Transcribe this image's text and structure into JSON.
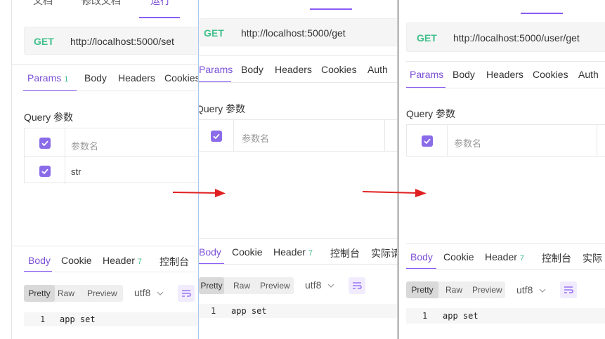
{
  "panels": [
    {
      "top_tabs": [
        "文档",
        "修改文档",
        "运行"
      ],
      "method": "GET",
      "url": "http://localhost:5000/set",
      "request_tabs": [
        {
          "label": "Params",
          "badge": "1"
        },
        {
          "label": "Body"
        },
        {
          "label": "Headers"
        },
        {
          "label": "Cookies"
        }
      ],
      "query_title": "Query 参数",
      "param_header": "参数名",
      "params": [
        {
          "name": "str"
        }
      ],
      "response_tabs": [
        {
          "label": "Body"
        },
        {
          "label": "Cookie"
        },
        {
          "label": "Header",
          "badge": "7"
        },
        {
          "label": "控制台"
        }
      ],
      "view_modes": [
        "Pretty",
        "Raw",
        "Preview"
      ],
      "encoding": "utf8",
      "code_lines": [
        {
          "no": "1",
          "text": "app set"
        }
      ]
    },
    {
      "method": "GET",
      "url": "http://localhost:5000/get",
      "request_tabs": [
        {
          "label": "Params"
        },
        {
          "label": "Body"
        },
        {
          "label": "Headers"
        },
        {
          "label": "Cookies"
        },
        {
          "label": "Auth"
        }
      ],
      "query_title": "Query 参数",
      "param_header": "参数名",
      "response_tabs": [
        {
          "label": "Body"
        },
        {
          "label": "Cookie"
        },
        {
          "label": "Header",
          "badge": "7"
        },
        {
          "label": "控制台"
        },
        {
          "label": "实际请"
        }
      ],
      "view_modes": [
        "Pretty",
        "Raw",
        "Preview"
      ],
      "encoding": "utf8",
      "code_lines": [
        {
          "no": "1",
          "text": "app set"
        }
      ]
    },
    {
      "method": "GET",
      "url": "http://localhost:5000/user/get",
      "request_tabs": [
        {
          "label": "Params"
        },
        {
          "label": "Body"
        },
        {
          "label": "Headers"
        },
        {
          "label": "Cookies"
        },
        {
          "label": "Auth"
        }
      ],
      "query_title": "Query 参数",
      "param_header": "参数名",
      "response_tabs": [
        {
          "label": "Body"
        },
        {
          "label": "Cookie"
        },
        {
          "label": "Header",
          "badge": "7"
        },
        {
          "label": "控制台"
        },
        {
          "label": "实际"
        }
      ],
      "view_modes": [
        "Pretty",
        "Raw",
        "Preview"
      ],
      "encoding": "utf8",
      "code_lines": [
        {
          "no": "1",
          "text": "app set"
        }
      ]
    }
  ],
  "colors": {
    "accent": "#8a5cf5",
    "method_get": "#3fbf8a",
    "arrow": "#e02020"
  },
  "icons": [
    "checkbox-checked-icon",
    "chevron-down-icon",
    "format-icon",
    "arrow-right-icon"
  ]
}
